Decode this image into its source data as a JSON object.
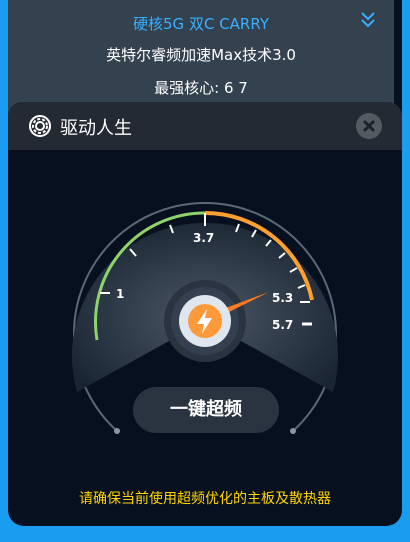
{
  "top_info": {
    "device_title": "硬核5G 双C CARRY",
    "feature_text": "英特尔睿频加速Max技术3.0",
    "strongest_cores": "最强核心: 6  7"
  },
  "app": {
    "title": "驱动人生"
  },
  "gauge": {
    "labels": [
      "1",
      "3.7",
      "5.3",
      "5.7"
    ],
    "colors": {
      "green": "#8fd46a",
      "orange": "#ff9f2f",
      "needle": "#ff7a22"
    }
  },
  "actions": {
    "boost_label": "一键超频"
  },
  "footer": {
    "warning": "请确保当前使用超频优化的主板及散热器"
  }
}
